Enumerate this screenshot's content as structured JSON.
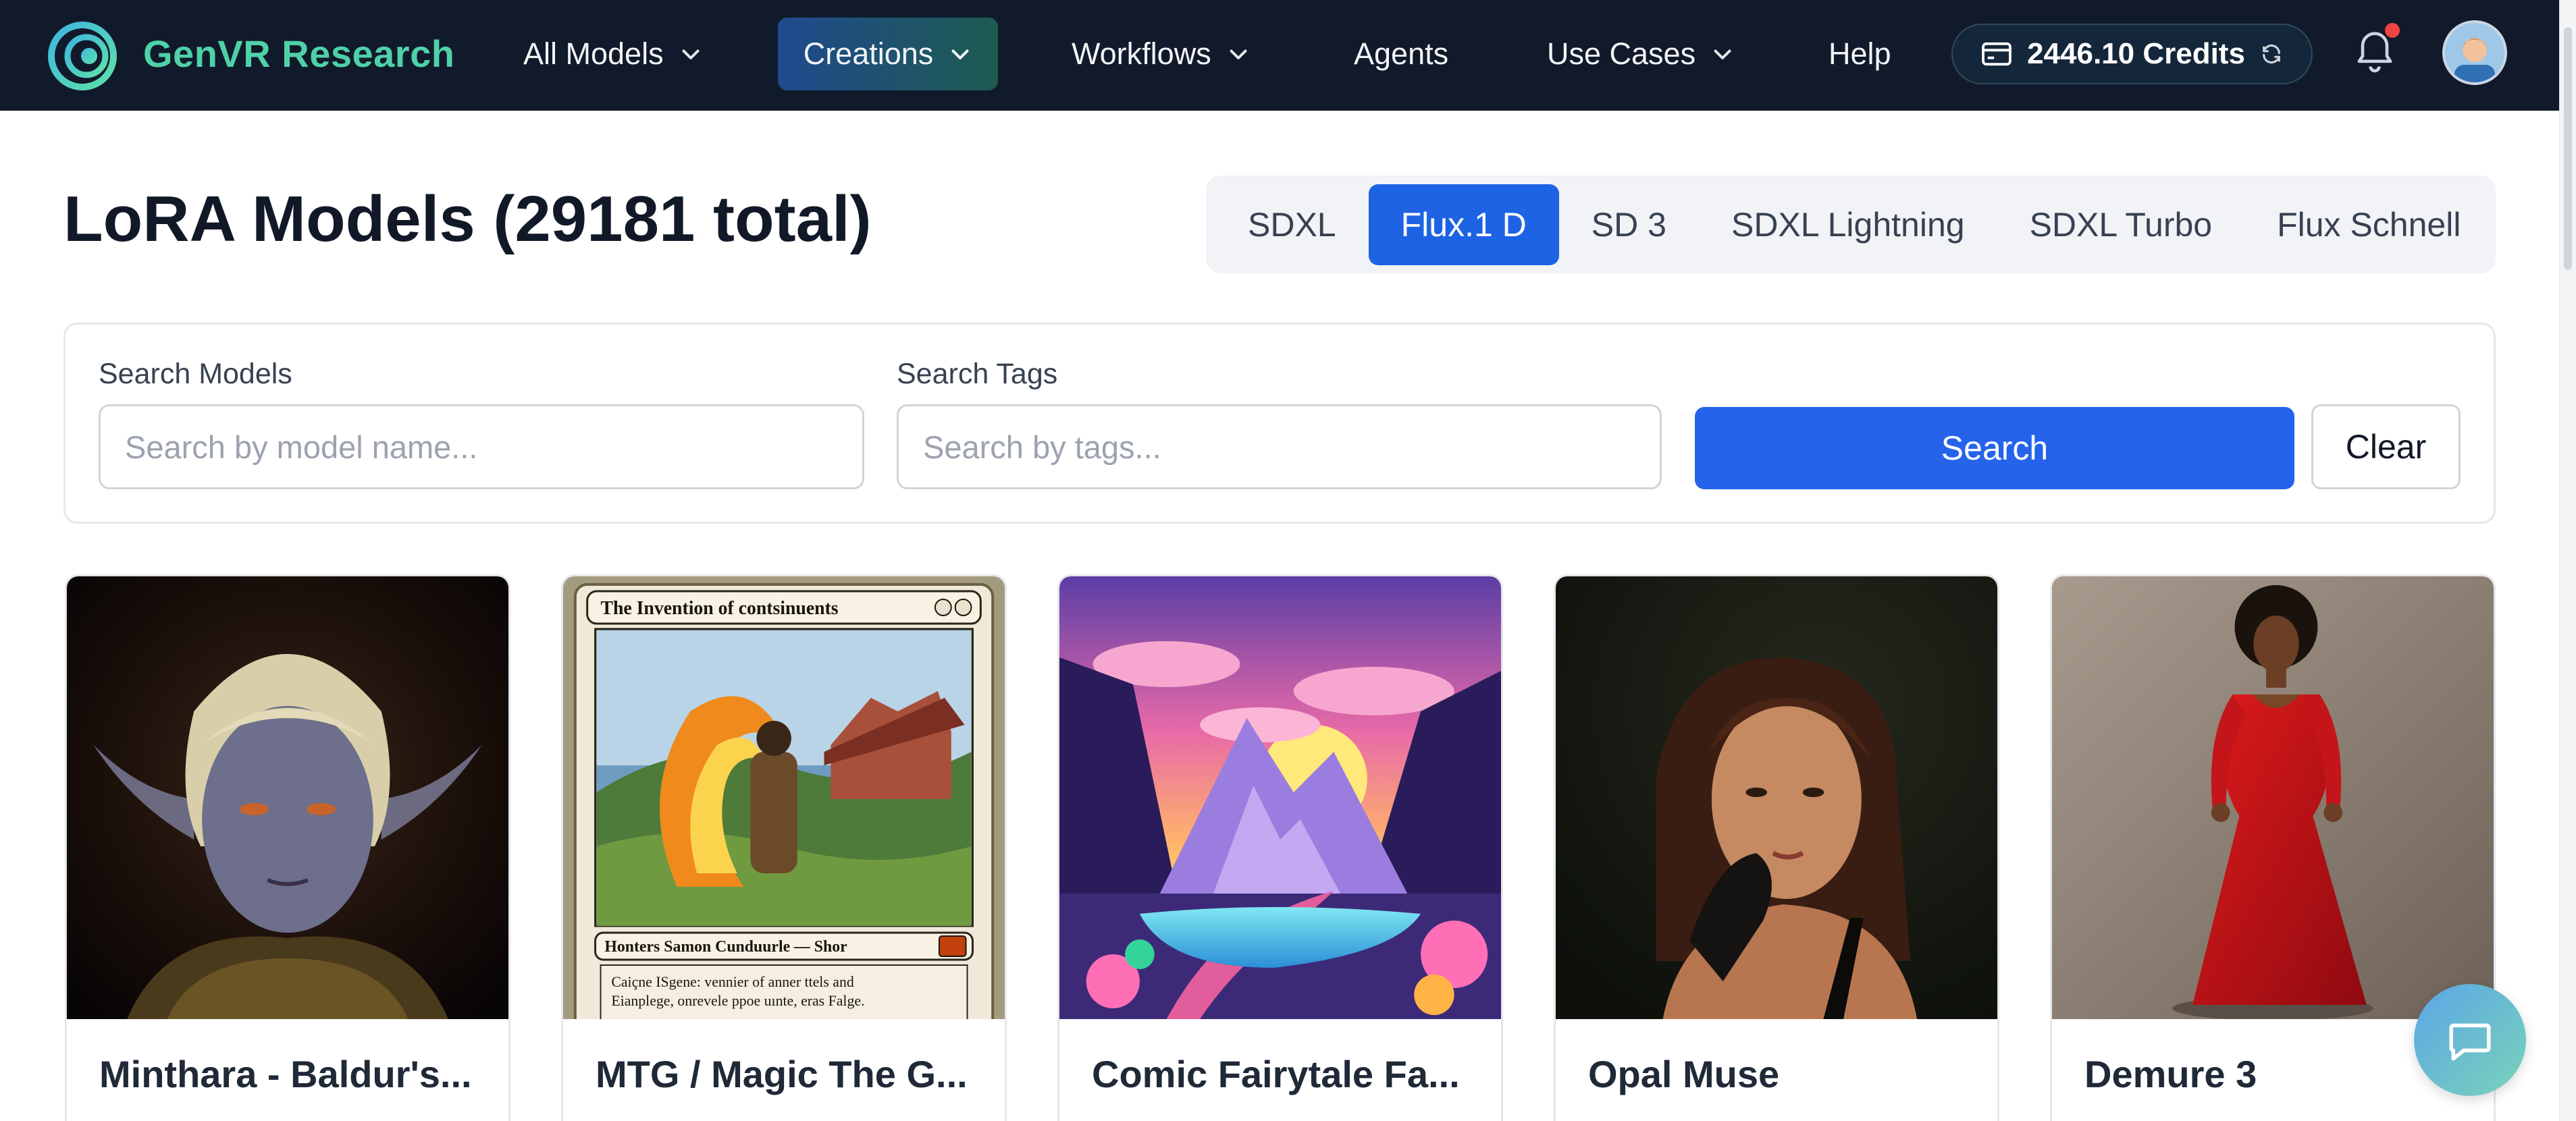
{
  "navbar": {
    "brand": "GenVR Research",
    "items": [
      {
        "label": "All Models",
        "dropdown": true
      },
      {
        "label": "Creations",
        "dropdown": true,
        "active": true
      },
      {
        "label": "Workflows",
        "dropdown": true
      },
      {
        "label": "Agents",
        "dropdown": false
      },
      {
        "label": "Use Cases",
        "dropdown": true
      },
      {
        "label": "Help",
        "dropdown": false
      }
    ],
    "credits": "2446.10 Credits",
    "icons": {
      "logo": "genvr-logo-icon",
      "credit": "credit-card-icon",
      "refresh": "refresh-icon",
      "bell": "bell-icon",
      "chevron": "chevron-down-icon"
    }
  },
  "page": {
    "title": "LoRA Models (29181 total)"
  },
  "model_tabs": [
    {
      "label": "SDXL",
      "active": false
    },
    {
      "label": "Flux.1 D",
      "active": true
    },
    {
      "label": "SD 3",
      "active": false
    },
    {
      "label": "SDXL Lightning",
      "active": false
    },
    {
      "label": "SDXL Turbo",
      "active": false
    },
    {
      "label": "Flux Schnell",
      "active": false
    }
  ],
  "search": {
    "models_label": "Search Models",
    "models_placeholder": "Search by model name...",
    "models_value": "",
    "tags_label": "Search Tags",
    "tags_placeholder": "Search by tags...",
    "tags_value": "",
    "search_button": "Search",
    "clear_button": "Clear"
  },
  "cards": [
    {
      "title": "Minthara - Baldur's..."
    },
    {
      "title": "MTG / Magic The G...",
      "mtg_card_title": "The Invention of contsinuents",
      "mtg_card_type": "Honters Samon Cunduurle — Shor",
      "mtg_card_text_1": "Caiçne ISgene: vennier of anner ttels and",
      "mtg_card_text_2": "Eianplege, onrevele ppoe uınte, eras Falge."
    },
    {
      "title": "Comic Fairytale Fa..."
    },
    {
      "title": "Opal Muse"
    },
    {
      "title": "Demure 3"
    }
  ],
  "colors": {
    "navbar_bg": "#111a2b",
    "brand": "#4fd1a8",
    "accent": "#2563eb",
    "notification": "#ef4444"
  }
}
